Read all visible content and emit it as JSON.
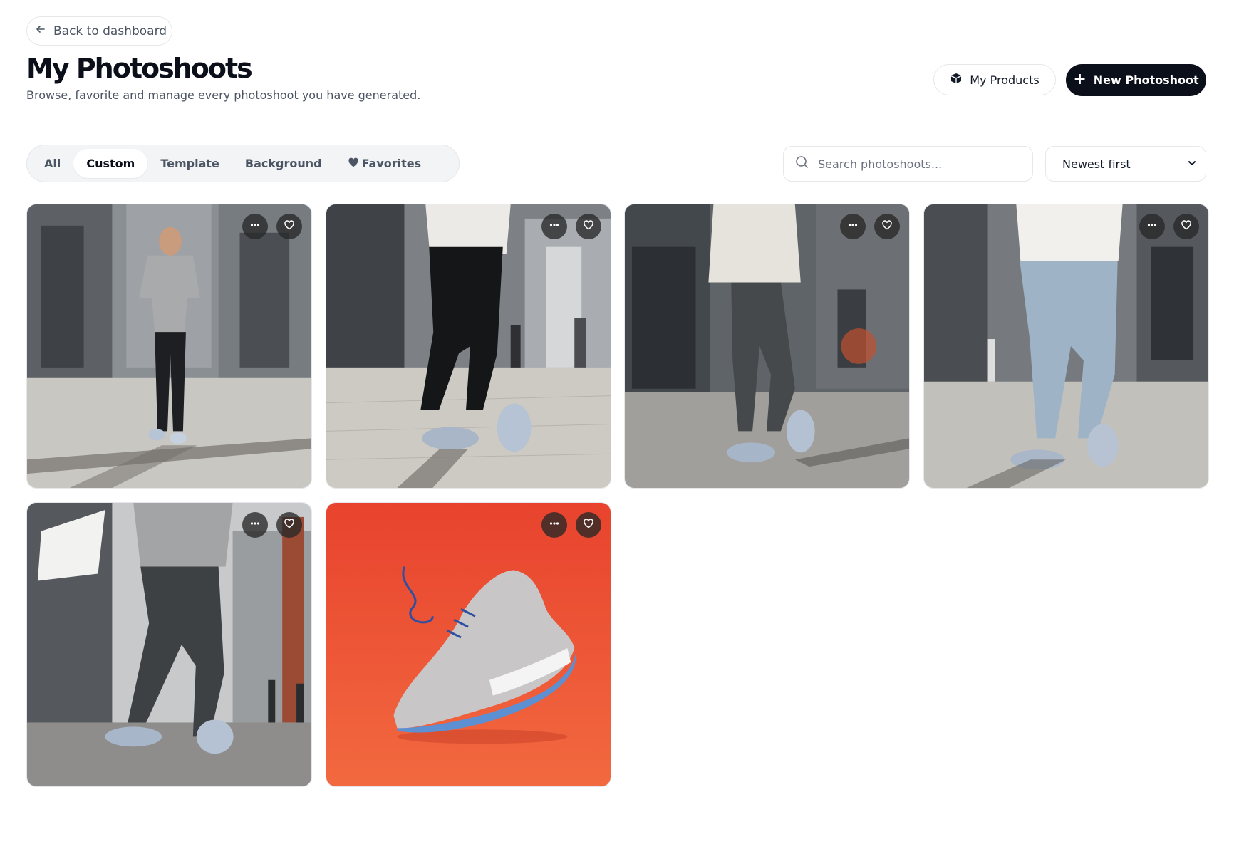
{
  "nav": {
    "back_label": "Back to dashboard"
  },
  "header": {
    "title": "My Photoshoots",
    "subtitle": "Browse, favorite and manage every photoshoot you have generated.",
    "my_products_label": "My Products",
    "new_photoshoot_label": "New Photoshoot"
  },
  "filters": {
    "tabs": [
      {
        "label": "All",
        "active": false
      },
      {
        "label": "Custom",
        "active": true
      },
      {
        "label": "Template",
        "active": false
      },
      {
        "label": "Background",
        "active": false
      },
      {
        "label": "Favorites",
        "active": false,
        "icon": "heart-icon"
      }
    ],
    "search_placeholder": "Search photoshoots...",
    "sort_value": "Newest first"
  },
  "photoshoots": [
    {
      "scene": "man in grey t-shirt and black jeans walking on city street",
      "favorite": false
    },
    {
      "scene": "close-up legs in black joggers and white t-shirt, sneakers on cobblestone",
      "favorite": false
    },
    {
      "scene": "man in cream hoodie and grey pants walking on street",
      "favorite": false
    },
    {
      "scene": "man in white t-shirt and light blue jeans walking on street",
      "favorite": false
    },
    {
      "scene": "man in grey sweatshirt and grey joggers walking, low angle",
      "favorite": false
    },
    {
      "scene": "grey knit running sneaker on red background",
      "favorite": false
    }
  ],
  "colors": {
    "primary_dark": "#0b0f19",
    "tab_bg": "#f3f4f6",
    "border": "#e5e7eb",
    "muted_text": "#4b5563",
    "overlay_button": "#282828",
    "product_background": "#e8432e"
  }
}
